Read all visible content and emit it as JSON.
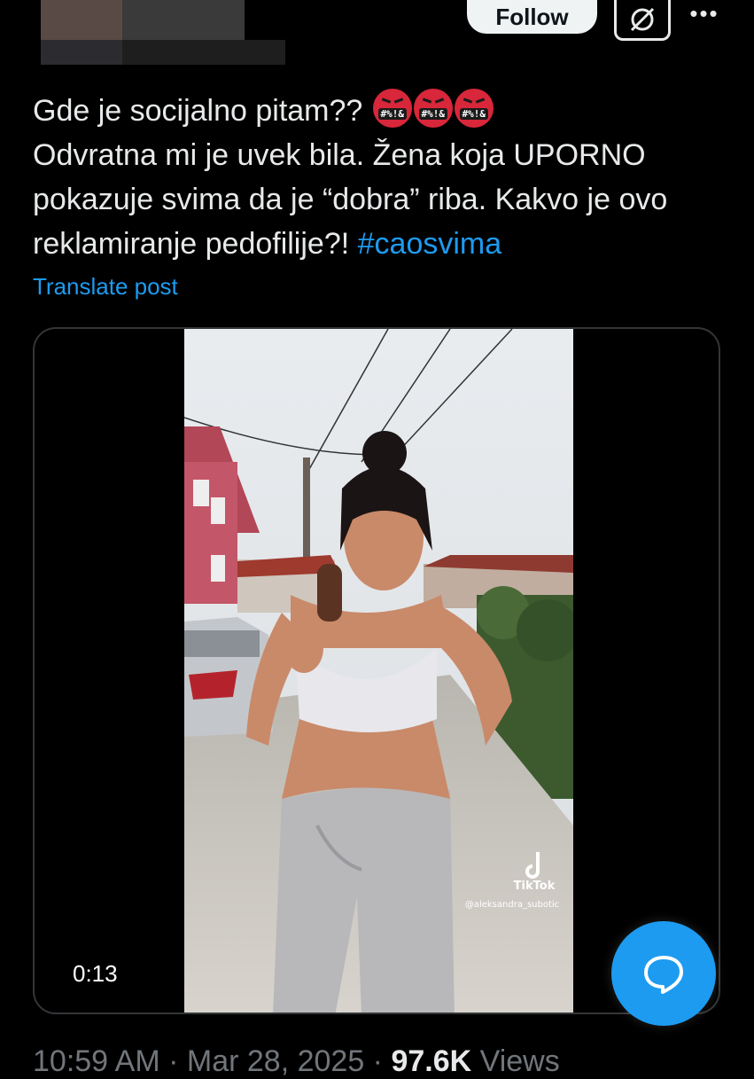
{
  "header": {
    "follow_label": "Follow",
    "grok_icon": "grok-slash-icon",
    "more_icon": "more-dots-icon",
    "more_text": "•••"
  },
  "post": {
    "line1": "Gde je socijalno pitam??",
    "emoji_text": "#%!&",
    "line2": "Odvratna mi je uvek bila. Žena koja UPORNO",
    "line3": "pokazuje svima da je “dobra” riba. Kakvo je ovo",
    "line4": "reklamiranje pedofilije?!",
    "hashtag": "#caosvima",
    "translate_label": "Translate post"
  },
  "video": {
    "duration": "0:13",
    "watermark_brand": "TikTok",
    "watermark_handle": "@aleksandra_subotic"
  },
  "footer": {
    "time": "10:59 AM",
    "date": "Mar 28, 2025",
    "views_count": "97.6K",
    "views_label": "Views"
  },
  "colors": {
    "accent": "#1d9bf0",
    "background": "#000000",
    "text": "#e7e9ea",
    "muted": "#71767b",
    "emoji_red": "#d8263a"
  }
}
